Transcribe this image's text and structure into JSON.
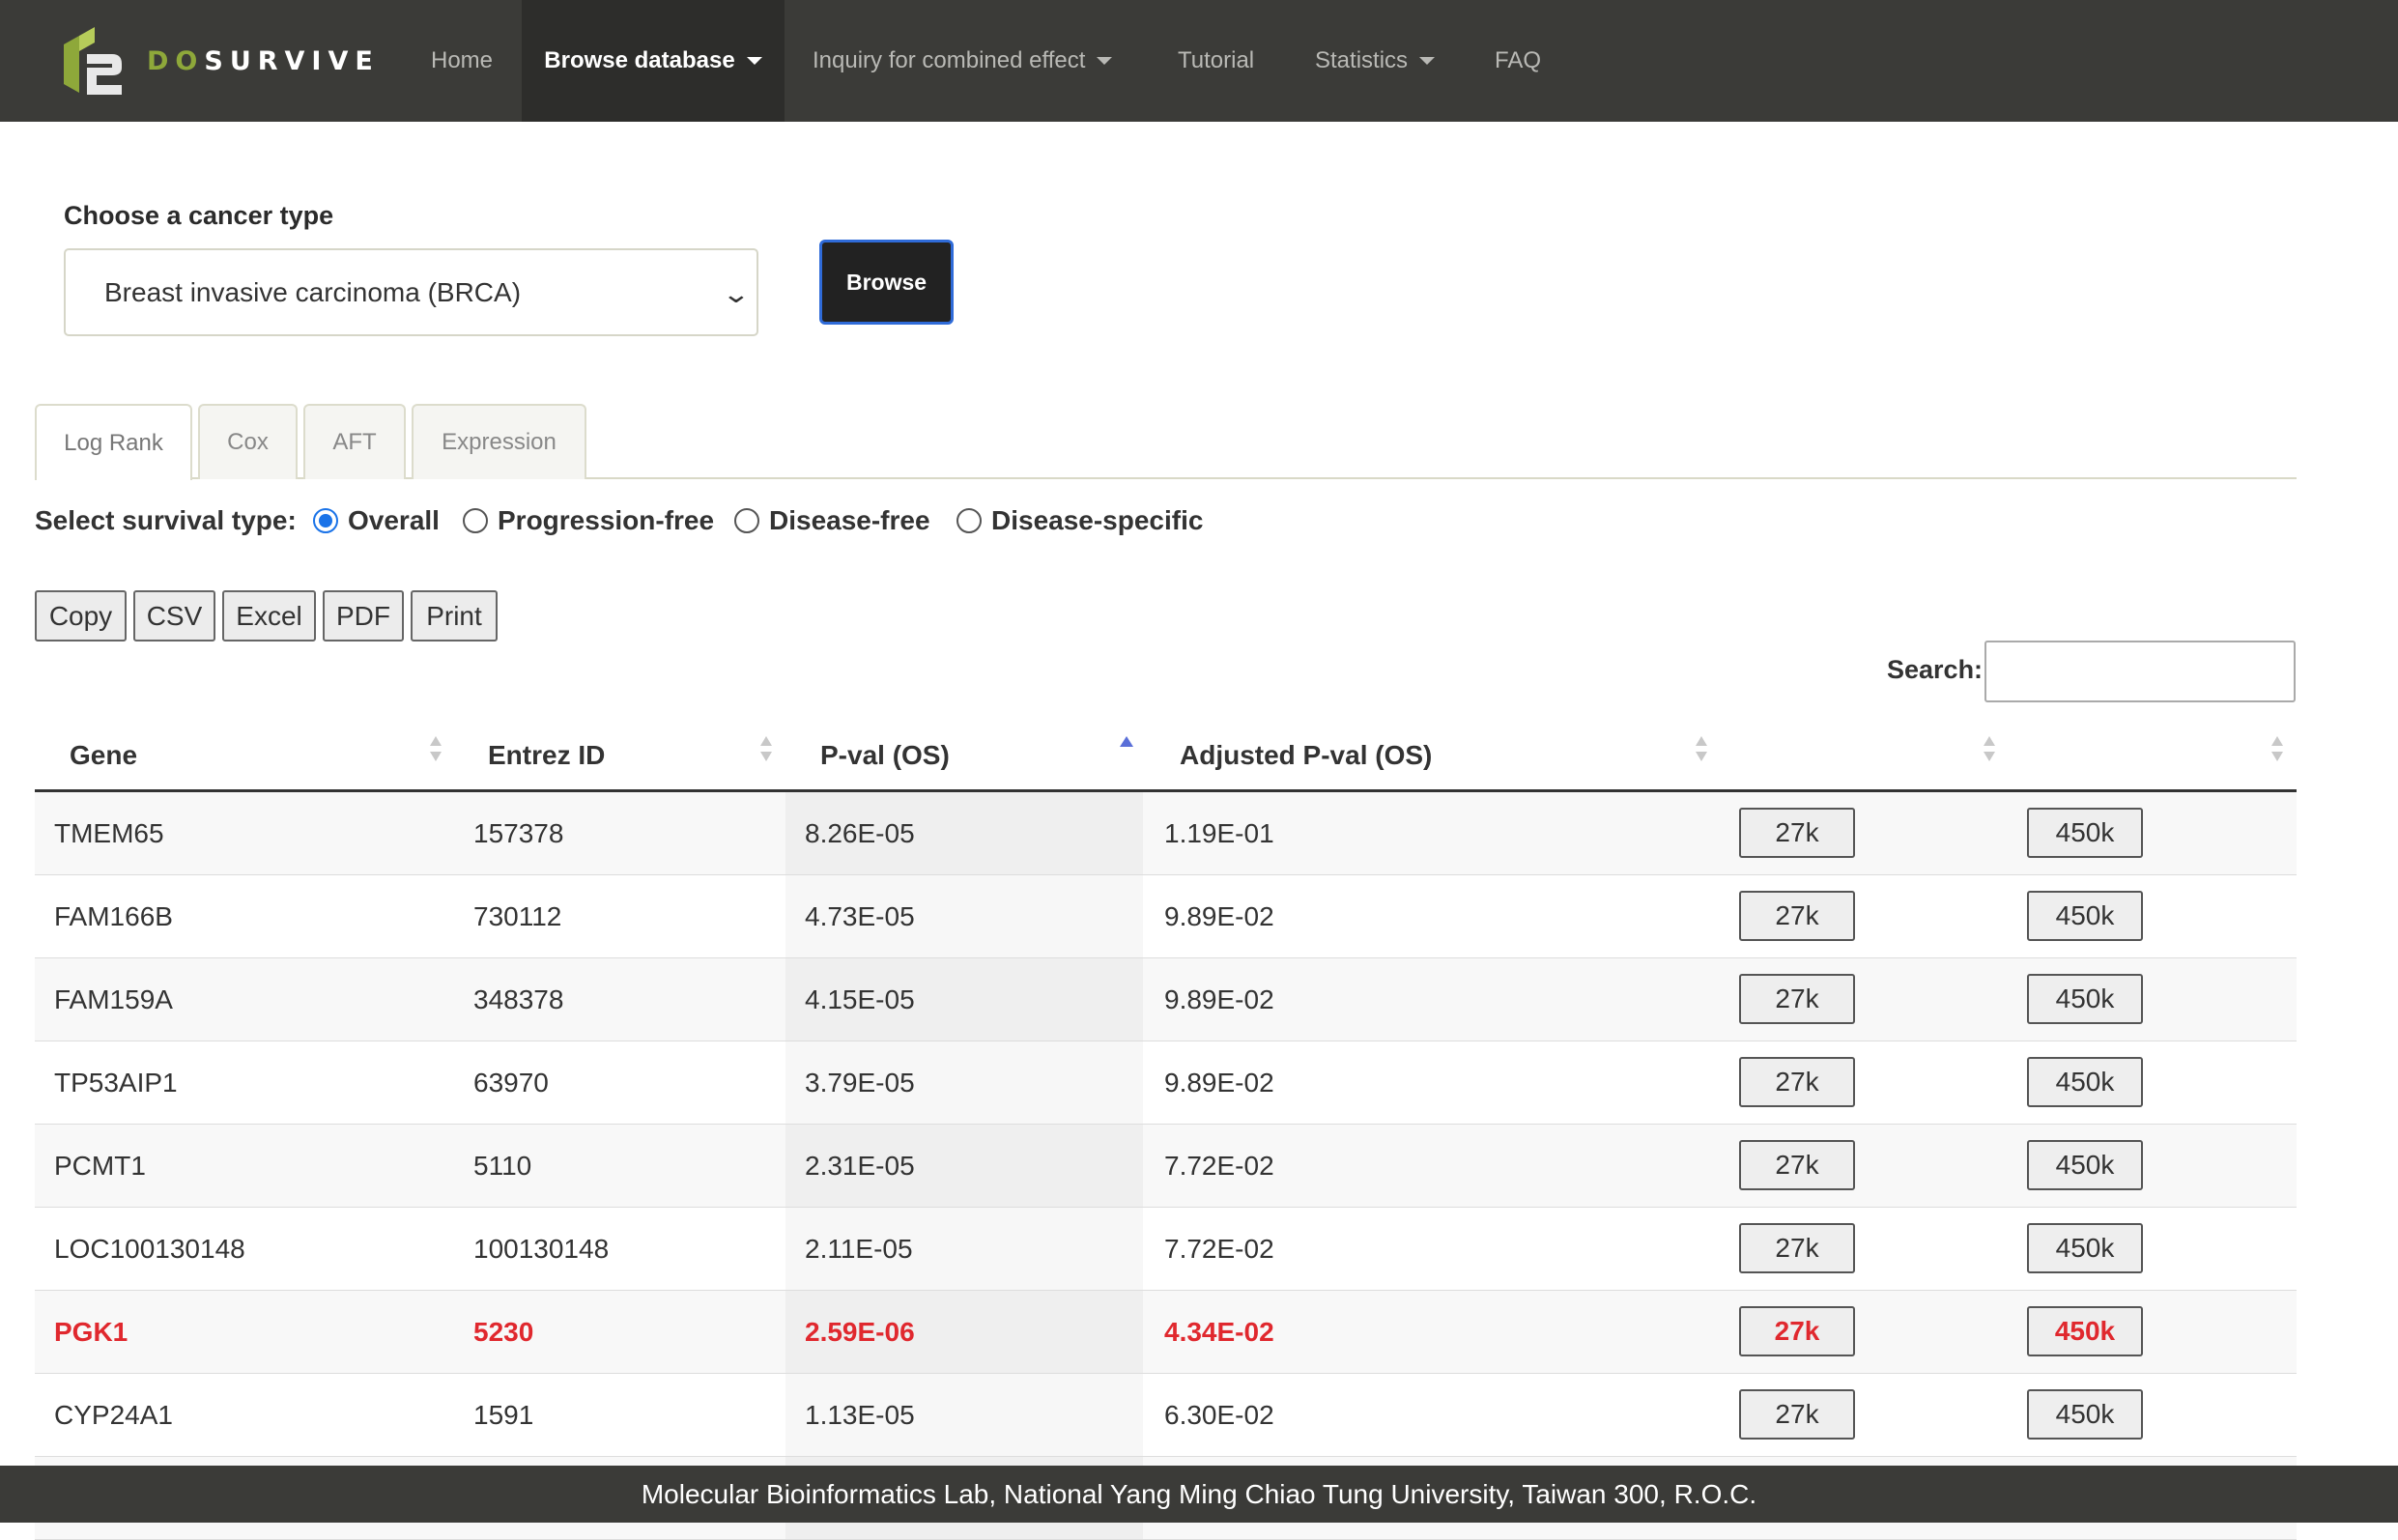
{
  "brand": {
    "prefix": "DO",
    "suffix": "SURVIVE",
    "accent": "#8ea83a"
  },
  "nav": {
    "items": [
      {
        "label": "Home",
        "dropdown": false
      },
      {
        "label": "Browse database",
        "dropdown": true,
        "active": true
      },
      {
        "label": "Inquiry for combined effect",
        "dropdown": true
      },
      {
        "label": "Tutorial",
        "dropdown": false
      },
      {
        "label": "Statistics",
        "dropdown": true
      },
      {
        "label": "FAQ",
        "dropdown": false
      }
    ]
  },
  "cancer": {
    "label": "Choose a cancer type",
    "selected": "Breast invasive carcinoma (BRCA)",
    "browse_label": "Browse"
  },
  "tabs": [
    {
      "label": "Log Rank",
      "active": true
    },
    {
      "label": "Cox"
    },
    {
      "label": "AFT"
    },
    {
      "label": "Expression"
    }
  ],
  "survival": {
    "label": "Select survival type:",
    "options": [
      {
        "label": "Overall",
        "checked": true
      },
      {
        "label": "Progression-free",
        "checked": false
      },
      {
        "label": "Disease-free",
        "checked": false
      },
      {
        "label": "Disease-specific",
        "checked": false
      }
    ]
  },
  "export_buttons": [
    "Copy",
    "CSV",
    "Excel",
    "PDF",
    "Print"
  ],
  "search": {
    "label": "Search:",
    "value": ""
  },
  "table": {
    "columns": [
      "Gene",
      "Entrez ID",
      "P-val (OS)",
      "Adjusted P-val (OS)",
      "",
      ""
    ],
    "sorted_column": "P-val (OS)",
    "sort_direction": "ascending",
    "highlight_color": "#e0282e",
    "rows": [
      {
        "gene": "TMEM65",
        "entrez": "157378",
        "pval": "8.26E-05",
        "adj": "1.19E-01",
        "b1": "27k",
        "b2": "450k",
        "highlight": false
      },
      {
        "gene": "FAM166B",
        "entrez": "730112",
        "pval": "4.73E-05",
        "adj": "9.89E-02",
        "b1": "27k",
        "b2": "450k",
        "highlight": false
      },
      {
        "gene": "FAM159A",
        "entrez": "348378",
        "pval": "4.15E-05",
        "adj": "9.89E-02",
        "b1": "27k",
        "b2": "450k",
        "highlight": false
      },
      {
        "gene": "TP53AIP1",
        "entrez": "63970",
        "pval": "3.79E-05",
        "adj": "9.89E-02",
        "b1": "27k",
        "b2": "450k",
        "highlight": false
      },
      {
        "gene": "PCMT1",
        "entrez": "5110",
        "pval": "2.31E-05",
        "adj": "7.72E-02",
        "b1": "27k",
        "b2": "450k",
        "highlight": false
      },
      {
        "gene": "LOC100130148",
        "entrez": "100130148",
        "pval": "2.11E-05",
        "adj": "7.72E-02",
        "b1": "27k",
        "b2": "450k",
        "highlight": false
      },
      {
        "gene": "PGK1",
        "entrez": "5230",
        "pval": "2.59E-06",
        "adj": "4.34E-02",
        "b1": "27k",
        "b2": "450k",
        "highlight": true
      },
      {
        "gene": "CYP24A1",
        "entrez": "1591",
        "pval": "1.13E-05",
        "adj": "6.30E-02",
        "b1": "27k",
        "b2": "450k",
        "highlight": false
      }
    ]
  },
  "footer": {
    "text": "Molecular Bioinformatics Lab, National Yang Ming Chiao Tung University, Taiwan 300, R.O.C."
  }
}
